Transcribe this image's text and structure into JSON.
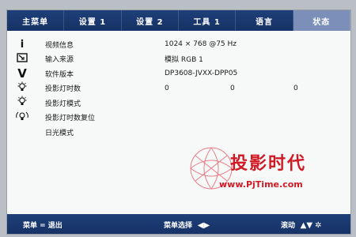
{
  "tabs": [
    "主菜单",
    "设置 1",
    "设置 2",
    "工具 1",
    "语言",
    "状态"
  ],
  "rows": [
    {
      "icon": "i",
      "label": "视频信息",
      "value": "1024 × 768 @75 Hz"
    },
    {
      "icon": "input",
      "label": "输入来源",
      "value": "模拟 RGB 1"
    },
    {
      "icon": "V",
      "label": "软件版本",
      "value": "DP3608-JVXX-DPP05"
    },
    {
      "icon": "lamp",
      "label": "投影灯时数",
      "values": [
        "0",
        "0",
        "0"
      ]
    },
    {
      "icon": "lamp",
      "label": "投影灯模式",
      "value": ""
    },
    {
      "icon": "lamp-reset",
      "label": "投影灯时数复位",
      "value": ""
    },
    {
      "icon": "",
      "label": "日光模式",
      "value": ""
    }
  ],
  "bottom": {
    "exit": "菜单 = 退出",
    "select": "菜单选择",
    "scroll": "滚动"
  },
  "watermark": {
    "cn": "投影时代",
    "url": "www.PjTime.com"
  },
  "colors": {
    "bar": "#1e3f78",
    "active_tab": "#7b8fb8",
    "watermark": "#d11a24"
  }
}
